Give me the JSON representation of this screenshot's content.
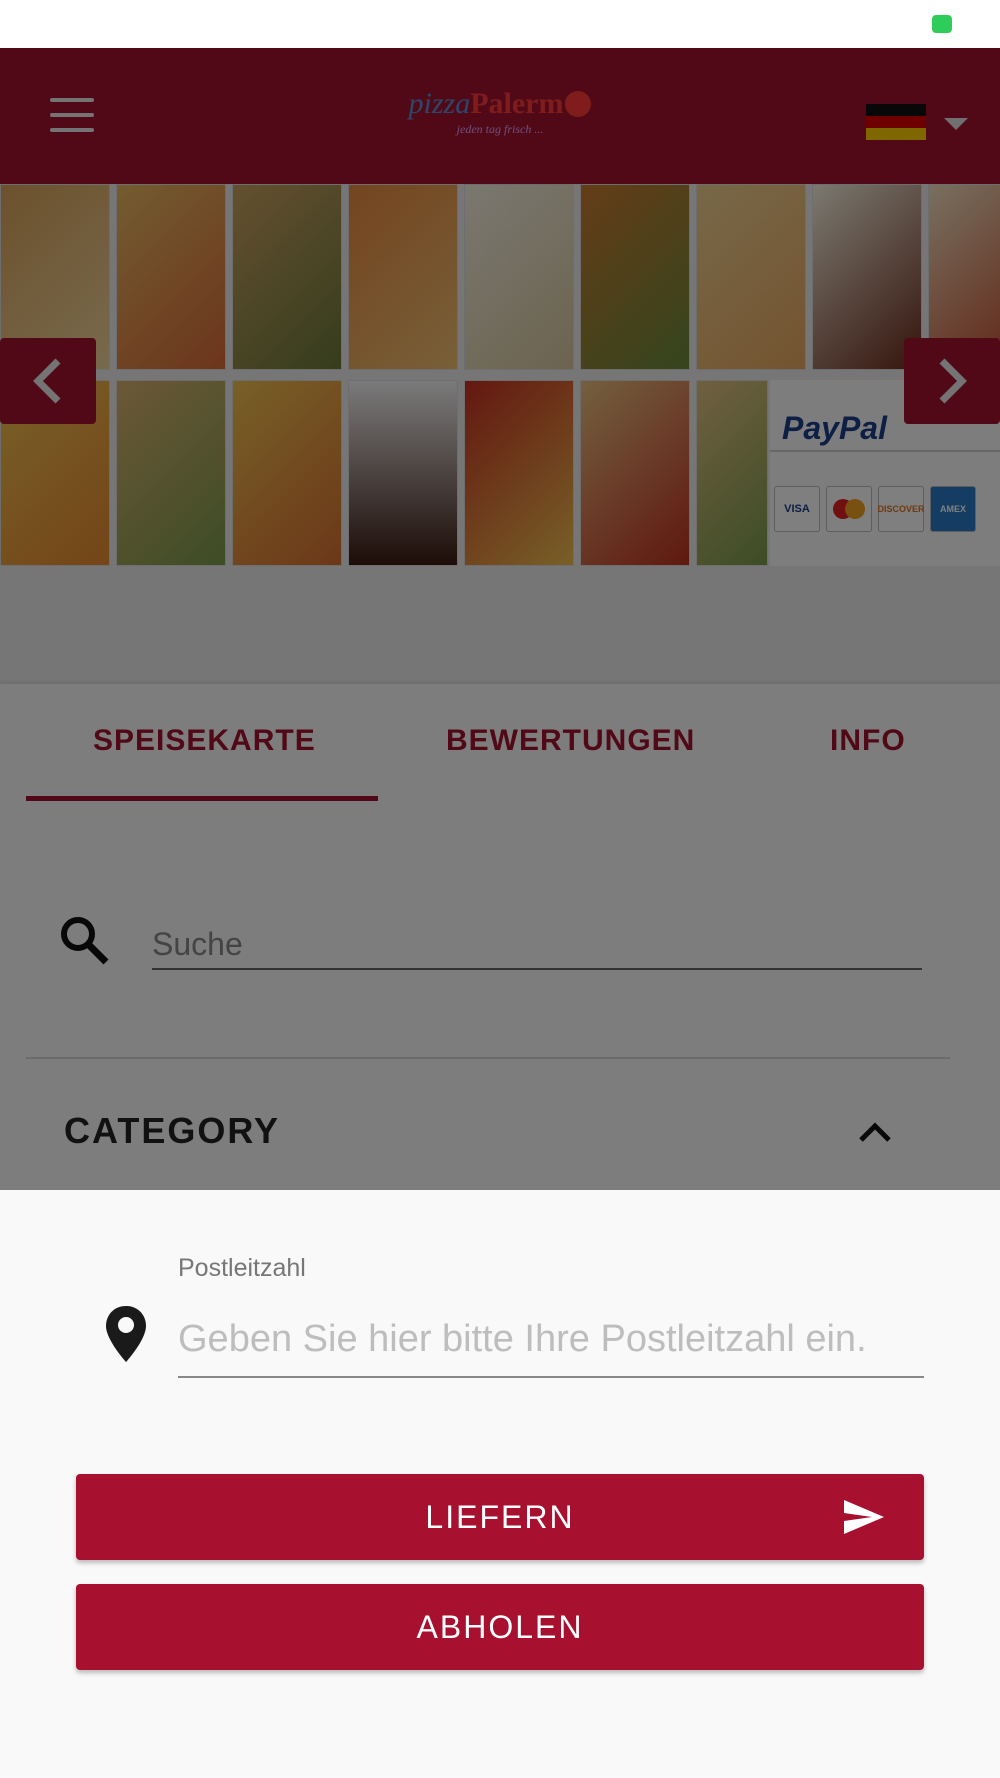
{
  "header": {
    "logo_main_left": "pizza",
    "logo_main_right": "Palerm",
    "logo_tagline": "jeden tag frisch ...",
    "language_flag": "de-flag-icon"
  },
  "banner": {
    "paypal_text": "PayPal",
    "cards": [
      "VISA",
      "MasterCard",
      "DISCOVER",
      "AMEX"
    ]
  },
  "tabs": [
    {
      "label": "SPEISEKARTE",
      "active": true
    },
    {
      "label": "BEWERTUNGEN",
      "active": false
    },
    {
      "label": "INFO",
      "active": false
    }
  ],
  "search": {
    "placeholder": "Suche",
    "value": ""
  },
  "category": {
    "title": "CATEGORY",
    "expanded": true
  },
  "delivery_sheet": {
    "zip_label": "Postleitzahl",
    "zip_placeholder": "Geben Sie hier bitte Ihre Postleitzahl ein.",
    "zip_value": "",
    "deliver_button": "LIEFERN",
    "pickup_button": "ABHOLEN"
  },
  "colors": {
    "brand_red": "#a8102f",
    "status_green": "#2ecc5a"
  }
}
